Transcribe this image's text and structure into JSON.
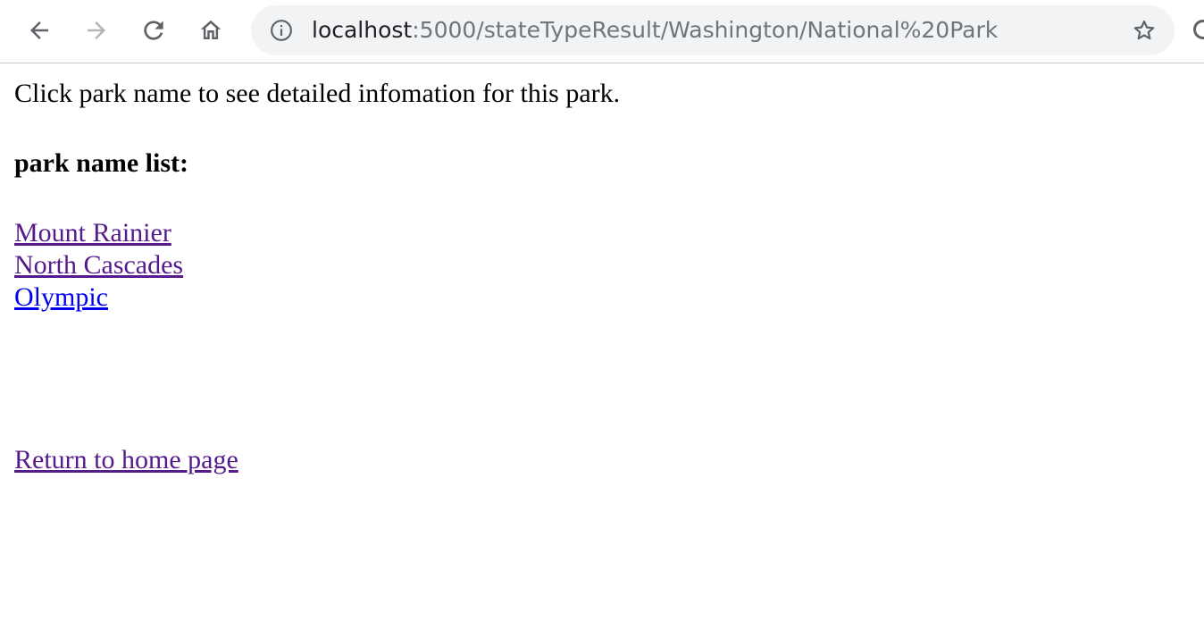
{
  "browser": {
    "url_host": "localhost",
    "url_rest": ":5000/stateTypeResult/Washington/National%20Park",
    "icons": {
      "back": "back-arrow-icon",
      "forward": "forward-arrow-icon",
      "reload": "reload-icon",
      "home": "home-icon",
      "site_info": "info-icon",
      "bookmark": "star-icon"
    }
  },
  "page": {
    "intro_text": "Click park name to see detailed infomation for this park.",
    "list_heading": "park name list:",
    "parks": [
      {
        "name": "Mount Rainier",
        "visited": true
      },
      {
        "name": "North Cascades",
        "visited": true
      },
      {
        "name": "Olympic",
        "visited": false
      }
    ],
    "return_link": "Return to home page"
  },
  "colors": {
    "visited_link": "#551a8b",
    "unvisited_link": "#0000ee",
    "omnibox_bg": "#f1f3f4"
  }
}
